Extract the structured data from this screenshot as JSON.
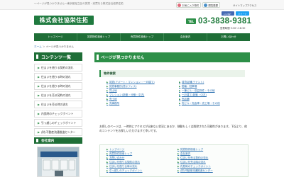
{
  "top": {
    "tagline": "〜ページが見つかりません〜東京都足立区の賃貸・売買なら株式会社協栄住拓",
    "fav_label": "お気に入り物件",
    "viewed_label": "閲覧履歴",
    "sitemap_label": "サイトマップ",
    "access_label": "アクセス"
  },
  "header": {
    "logo_text": "株式会社協栄住拓",
    "tel_label": "TEL",
    "phone": "03-3838-9381",
    "hours": "営業時間 9:30～18:30",
    "share_like": "いいね！",
    "share_tweet": "ツイート"
  },
  "nav": [
    {
      "label": "トップページ"
    },
    {
      "label": "賃貸物件検索トップ"
    },
    {
      "label": "売買物件検索トップ"
    },
    {
      "label": "会社案内"
    },
    {
      "label": "お問い合わせ"
    }
  ],
  "breadcrumb": {
    "home": "ホーム",
    "sep": "＞",
    "current": "ページが見つかりません"
  },
  "sidebar": {
    "title": "コンテンツ一覧",
    "items": [
      {
        "label": "住まいを借りる契約の流れ"
      },
      {
        "label": "住まいを借りる時の流れ"
      },
      {
        "label": "住まいを借りる時の流れ"
      },
      {
        "label": "住まいを売る契約の流れ"
      },
      {
        "label": "住まいを売る時の流れ"
      },
      {
        "label": "内見時のチェックポイント"
      },
      {
        "label": "引っ越しのチェックポイント"
      },
      {
        "label": "(財)不動産流通推進センター"
      }
    ],
    "company_title": "会社案内"
  },
  "main": {
    "title": "ページが見つかりません",
    "section_head": "物件検索",
    "links_left": [
      "賃貸(アパート・マンション・一戸建て)",
      "賃貸事務所(貸オフィス)",
      "貸土地",
      "マンション(新築・分譲・中古)",
      "売土地",
      "売事務所"
    ],
    "links_right": [
      "賃貸店舗(テナント)",
      "駐輪・駐車場",
      "一棟ビル・収益物件・その他",
      "一戸建て(新築・中古)",
      "売店舗",
      "売ビル・売倉庫・売工場・その他"
    ],
    "notice": "お探しのページは、一時的にアクセスが出来ない状況にあるか、移動もしくは削除された可能性があります。下記より、他のコンテンツをお探しいただけますと幸いです。",
    "foot_left": [
      "トップページ",
      "売買物件検索トップ",
      "お問い合わせ",
      "住まいを借りる契約の流れ",
      "住まいを借りる時の流れ",
      "引っ越しのチェックポイント"
    ],
    "foot_right": [
      "賃貸物件検索トップ",
      "会社案内",
      "住まいを売る契約の流れ",
      "住まいを売る時の流れ",
      "内見時のチェックポイント",
      "(財)不動産流通推進センター"
    ]
  },
  "colors": {
    "brand_green": "#1f6e37",
    "accent_green": "#2d8f48",
    "link_blue": "#2a6fb0"
  },
  "icons": {
    "fav": "heart-icon",
    "viewed": "clock-icon",
    "arrow": "chevron-right-icon"
  }
}
